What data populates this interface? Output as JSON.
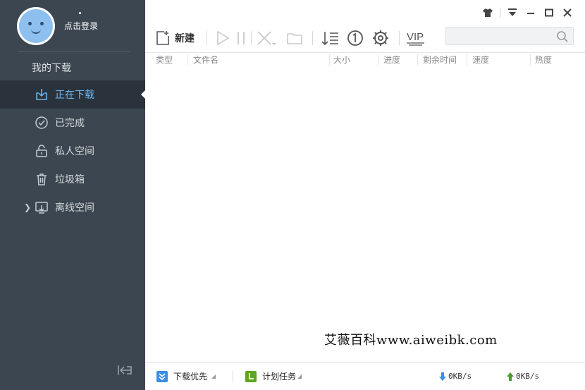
{
  "profile": {
    "login_text": "点击登录"
  },
  "sidebar": {
    "section_title": "我的下载",
    "items": [
      {
        "label": "正在下载",
        "active": true
      },
      {
        "label": "已完成",
        "active": false
      },
      {
        "label": "私人空间",
        "active": false
      },
      {
        "label": "垃圾箱",
        "active": false
      },
      {
        "label": "离线空间",
        "active": false
      }
    ]
  },
  "toolbar": {
    "new_label": "新建",
    "vip_label": "VIP",
    "search": {
      "placeholder": "",
      "value": ""
    }
  },
  "columns": [
    "类型",
    "文件名",
    "大小",
    "进度",
    "剩余时间",
    "速度",
    "热度"
  ],
  "watermark": "艾薇百科www.aiweibk.com",
  "footer": {
    "priority_label": "下载优先",
    "schedule_label": "计划任务",
    "download_speed": "0KB/s",
    "upload_speed": "0KB/s"
  },
  "colors": {
    "sidebar_bg": "#3b4650",
    "active_bg": "#2a333b",
    "accent_blue": "#6bb4f2",
    "schedule_green": "#5aa61d",
    "priority_blue": "#3a8ee6",
    "upload_green": "#4a9d2b"
  }
}
